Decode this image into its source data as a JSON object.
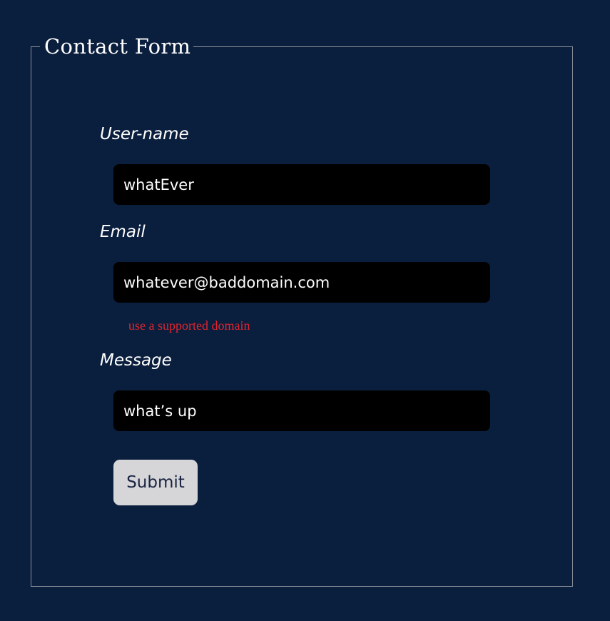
{
  "form": {
    "title": "Contact Form",
    "fields": {
      "username": {
        "label": "User-name",
        "value": "whatEver"
      },
      "email": {
        "label": "Email",
        "value": "whatever@baddomain.com",
        "error": "use a supported domain"
      },
      "message": {
        "label": "Message",
        "value": "what’s up"
      }
    },
    "submit_label": "Submit"
  },
  "colors": {
    "background": "#0a1e3d",
    "input_background": "#000000",
    "error": "#e0262f",
    "button_background": "#d6d6d8",
    "button_text": "#1a2342"
  }
}
